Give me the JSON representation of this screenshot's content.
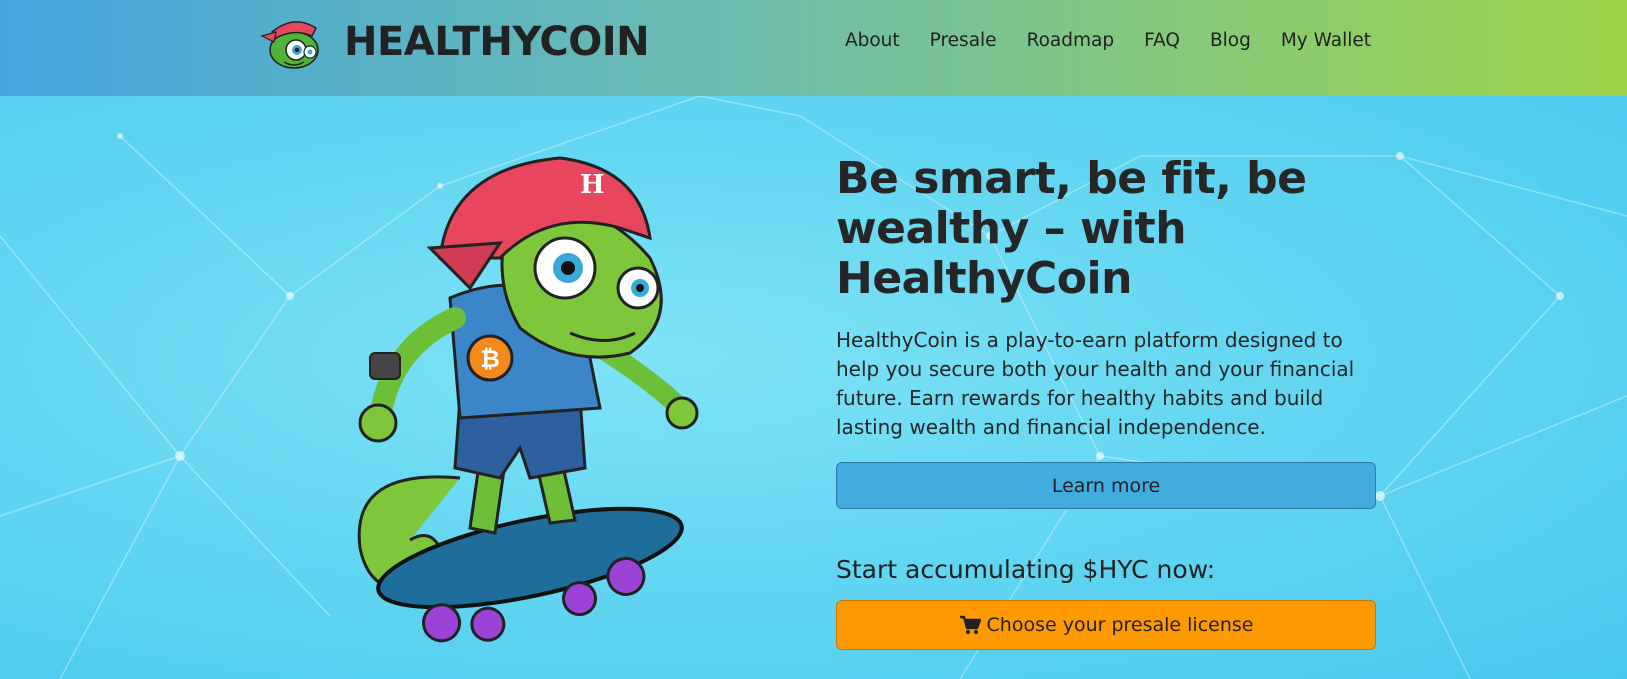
{
  "brand": {
    "name": "HEALTHYCOIN",
    "logo_icon": "chameleon-mascot-icon"
  },
  "nav": {
    "items": [
      {
        "label": "About"
      },
      {
        "label": "Presale"
      },
      {
        "label": "Roadmap"
      },
      {
        "label": "FAQ"
      },
      {
        "label": "Blog"
      },
      {
        "label": "My Wallet"
      }
    ]
  },
  "hero": {
    "headline": "Be smart, be fit, be wealthy – with HealthyCoin",
    "description": "HealthyCoin is a play-to-earn platform designed to help you secure both your health and your financial future. Earn rewards for healthy habits and build lasting wealth and financial independence.",
    "learn_more_label": "Learn more",
    "cta_heading": "Start accumulating $HYC now:",
    "presale_label": "Choose your presale license",
    "presale_icon": "shopping-cart-icon",
    "mascot": "chameleon-skateboard-illustration"
  },
  "colors": {
    "nav_gradient_start": "#45a5df",
    "nav_gradient_end": "#9dd247",
    "hero_bg": "#5fd4f1",
    "learn_button": "#43acdf",
    "presale_button": "#fd9a01"
  }
}
